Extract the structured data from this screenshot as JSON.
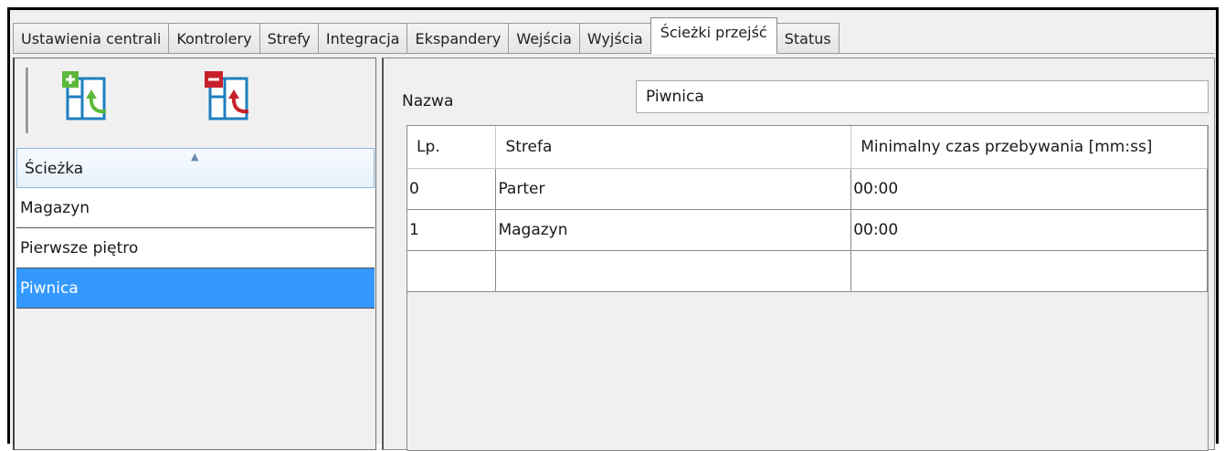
{
  "tabs": [
    {
      "label": "Ustawienia centrali"
    },
    {
      "label": "Kontrolery"
    },
    {
      "label": "Strefy"
    },
    {
      "label": "Integracja"
    },
    {
      "label": "Ekspandery"
    },
    {
      "label": "Wejścia"
    },
    {
      "label": "Wyjścia"
    },
    {
      "label": "Ścieżki przejść",
      "active": true
    },
    {
      "label": "Status"
    }
  ],
  "toolbar": {
    "add_icon": "add-path-icon",
    "remove_icon": "remove-path-icon",
    "colors": {
      "add": "#5cb83a",
      "remove": "#c8202a",
      "frame": "#1e7fc0"
    }
  },
  "path_list": {
    "header": "Ścieżka",
    "items": [
      {
        "label": "Magazyn"
      },
      {
        "label": "Pierwsze piętro"
      },
      {
        "label": "Piwnica",
        "selected": true
      }
    ]
  },
  "detail": {
    "name_label": "Nazwa",
    "name_value": "Piwnica",
    "columns": [
      "Lp.",
      "Strefa",
      "Minimalny czas przebywania [mm:ss]"
    ],
    "rows": [
      [
        "0",
        "Parter",
        "00:00"
      ],
      [
        "1",
        "Magazyn",
        "00:00"
      ],
      [
        "",
        "",
        ""
      ]
    ]
  },
  "colors": {
    "selection": "#3399ff",
    "header_bg": "#e6f1fb"
  }
}
